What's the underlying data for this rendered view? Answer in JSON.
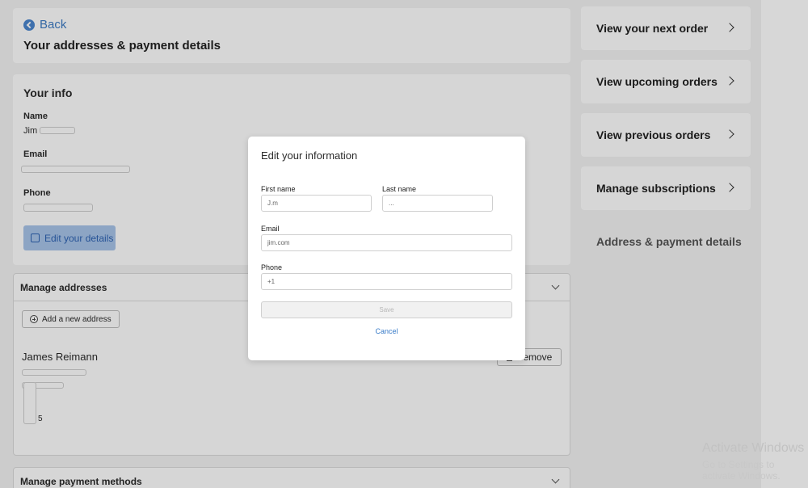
{
  "header": {
    "back_label": "Back",
    "title": "Your addresses & payment details"
  },
  "info": {
    "title": "Your info",
    "name_label": "Name",
    "name_value": "Jim",
    "email_label": "Email",
    "phone_label": "Phone",
    "edit_button": "Edit your details"
  },
  "addresses": {
    "title": "Manage addresses",
    "add_button": "Add a new address",
    "entry_name": "James Reimann",
    "remove_button": "Remove",
    "partial_line": "5"
  },
  "payments": {
    "title": "Manage payment methods"
  },
  "sidebar": {
    "items": [
      {
        "label": "View your next order"
      },
      {
        "label": "View upcoming orders"
      },
      {
        "label": "View previous orders"
      },
      {
        "label": "Manage subscriptions"
      },
      {
        "label": "Address & payment details"
      }
    ]
  },
  "modal": {
    "title": "Edit your information",
    "first_name_label": "First name",
    "first_name_value": "J.m",
    "last_name_label": "Last name",
    "last_name_value": "...",
    "email_label": "Email",
    "email_value": "jim.com",
    "phone_label": "Phone",
    "phone_value": "+1",
    "save_label": "Save",
    "cancel_label": "Cancel"
  },
  "watermark": {
    "title": "Activate Windows",
    "subtitle": "Go to Settings to activate Windows."
  }
}
